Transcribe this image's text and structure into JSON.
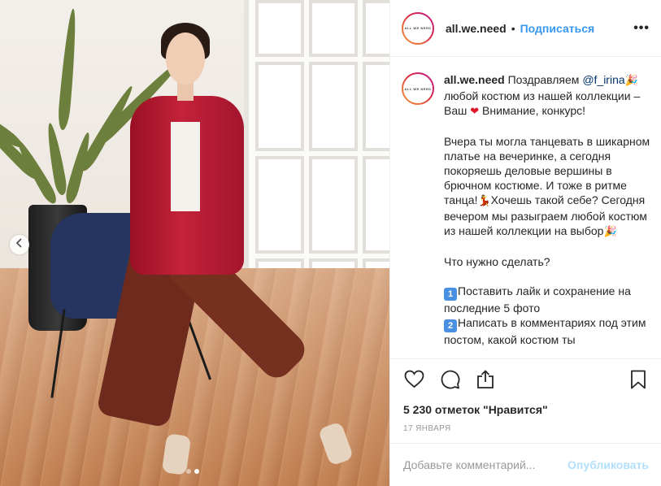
{
  "post": {
    "username": "all.we.need",
    "avatar_text": "ALL WE NEED",
    "separator": "•",
    "follow_label": "Подписаться",
    "more_label": "•••"
  },
  "caption": {
    "username": "all.we.need",
    "line1_a": "Поздравляем ",
    "mention": "@f_irina",
    "emoji_party": "🎉",
    "line1_b": "любой костюм из нашей коллекции – Ваш ",
    "emoji_heart": "❤",
    "line1_c": " Внимание, конкурс!",
    "para2_a": "Вчера ты могла танцевать в шикарном платье на вечеринке, а сегодня покоряешь деловые вершины в брючном костюме. И тоже в ритме танца!",
    "emoji_dancer": "💃",
    "para2_b": "Хочешь такой себе? Сегодня вечером мы разыграем любой костюм из нашей коллекции на выбор",
    "emoji_party2": "🎉",
    "para3": "Что нужно сделать?",
    "step1_num": "1",
    "step1": "Поставить лайк и сохранение на последние 5 фото",
    "step2_num": "2",
    "step2": "Написать в комментариях под этим постом, какой костюм ты"
  },
  "actions": {
    "likes": "5 230 отметок \"Нравится\"",
    "date": "17 ЯНВАРЯ"
  },
  "comment": {
    "placeholder": "Добавьте комментарий...",
    "publish_label": "Опубликовать"
  },
  "carousel": {
    "count": 2,
    "active_index": 1
  },
  "icons": [
    "chevron-left-icon",
    "heart-icon",
    "comment-icon",
    "share-icon",
    "bookmark-icon"
  ],
  "colors": {
    "link": "#3897f0",
    "mention": "#003569",
    "publish_disabled": "#b2dffc",
    "muted": "#999999"
  }
}
